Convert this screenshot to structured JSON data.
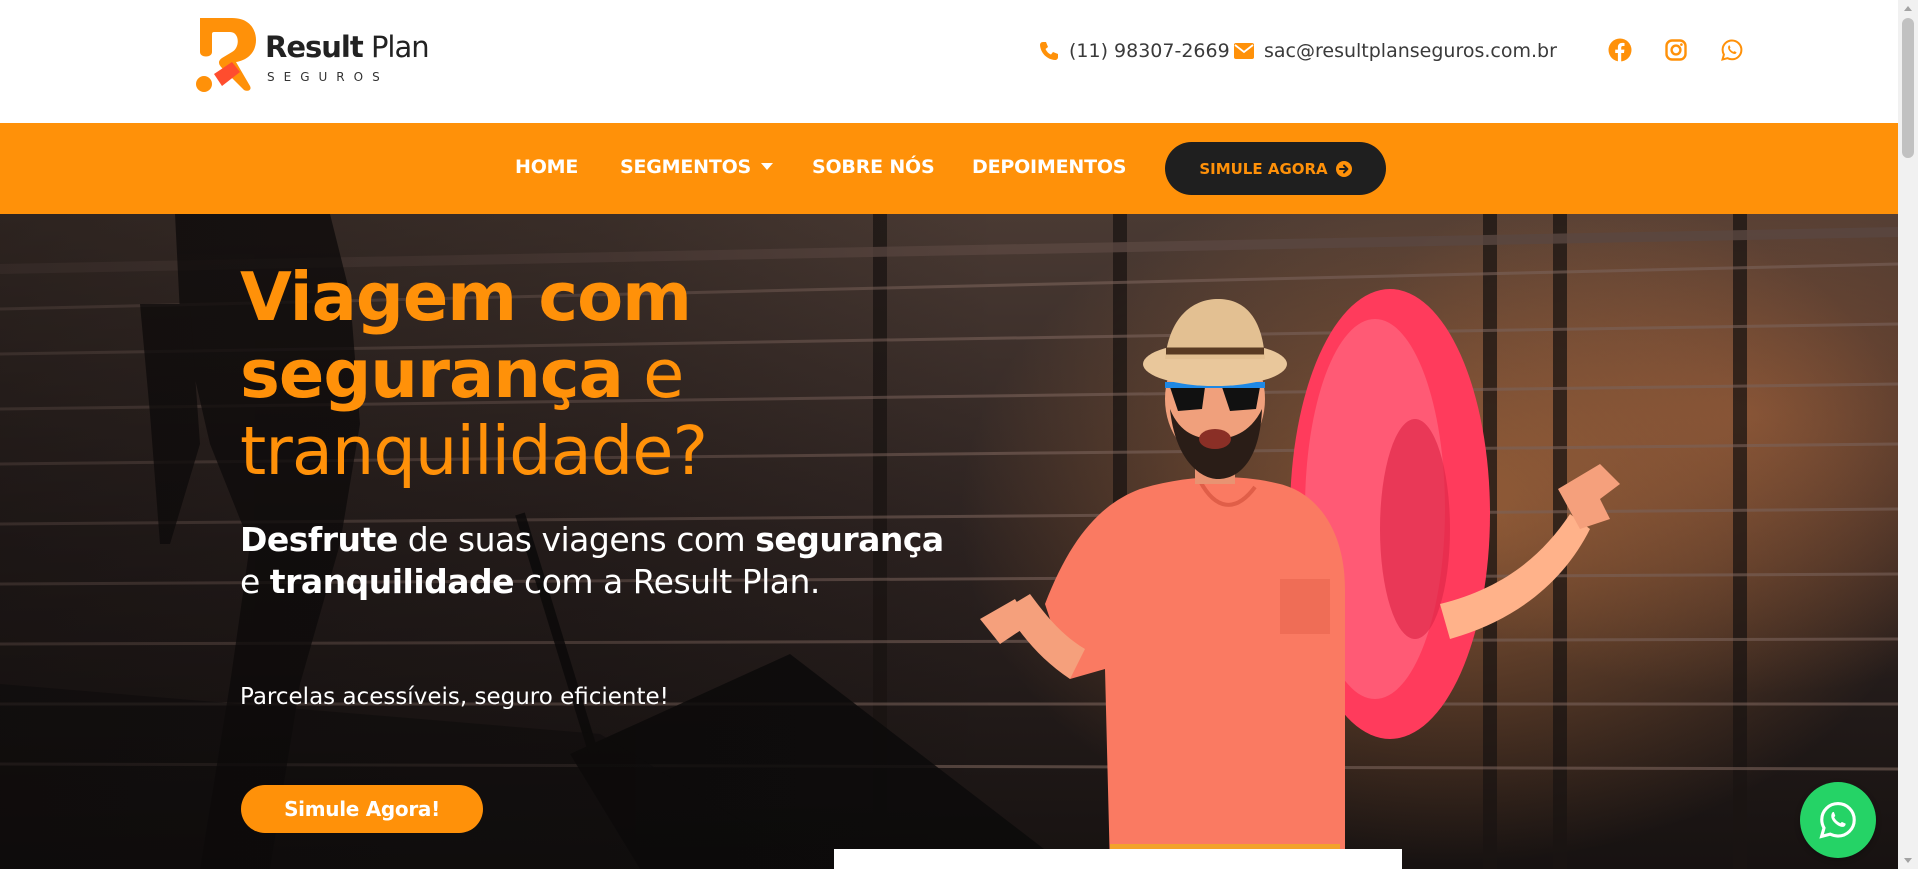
{
  "brand": {
    "name_bold": "Result",
    "name_light": "Plan",
    "tagline": "SEGUROS",
    "primary_color": "#FF9109",
    "dark_color": "#1f1f1f"
  },
  "header": {
    "phone": "(11) 98307-2669",
    "email": "sac@resultplanseguros.com.br",
    "phone_icon": "phone-icon",
    "email_icon": "envelope-icon",
    "social": [
      "facebook-icon",
      "instagram-icon",
      "whatsapp-icon"
    ]
  },
  "nav": {
    "items": [
      {
        "label": "HOME"
      },
      {
        "label": "SEGMENTOS"
      },
      {
        "label": "SOBRE NÓS"
      },
      {
        "label": "DEPOIMENTOS"
      }
    ],
    "cta_label": "SIMULE AGORA"
  },
  "hero": {
    "title_line1": "Viagem com",
    "title_line2_bold": "segurança",
    "title_line2_light": " e",
    "title_line3": "tranquilidade?",
    "sub_1": "Desfrute",
    "sub_2": " de suas viagens com ",
    "sub_3": "segurança",
    "sub_4": " e ",
    "sub_5": "tranquilidade",
    "sub_6": " com a Result Plan.",
    "tagline": "Parcelas acessíveis, seguro eficiente!",
    "cta_label": "Simule Agora!"
  },
  "floating": {
    "whatsapp_icon": "whatsapp-icon",
    "whatsapp_color": "#25D366"
  }
}
